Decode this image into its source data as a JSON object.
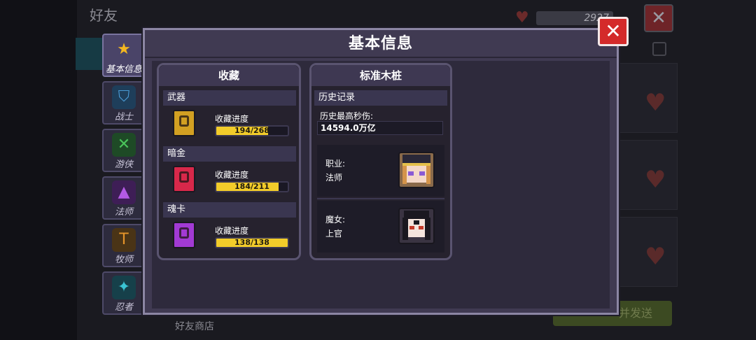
{
  "background": {
    "title": "好友",
    "currency_value": "2927",
    "send_button": "并发送",
    "shop_label": "好友商店"
  },
  "sidebar": {
    "tabs": [
      {
        "label": "基本信息",
        "icon": "star-icon",
        "active": true,
        "color": "#f4b820"
      },
      {
        "label": "战士",
        "icon": "shield-icon",
        "active": false,
        "color": "#2a6a9a"
      },
      {
        "label": "游侠",
        "icon": "crossbow-icon",
        "active": false,
        "color": "#2a8a3a"
      },
      {
        "label": "法师",
        "icon": "wizard-icon",
        "active": false,
        "color": "#8a3ab4"
      },
      {
        "label": "牧师",
        "icon": "hammer-icon",
        "active": false,
        "color": "#c47a1a"
      },
      {
        "label": "忍者",
        "icon": "shuriken-icon",
        "active": false,
        "color": "#2a9aa4"
      }
    ]
  },
  "modal": {
    "title": "基本信息",
    "close_icon": "close-icon"
  },
  "collection": {
    "title": "收藏",
    "sections": [
      {
        "name": "武器",
        "progress_label": "收藏进度",
        "progress_text": "194/268",
        "current": 194,
        "total": 268,
        "icon": "weapon-book-icon",
        "icon_color": "#d2a022"
      },
      {
        "name": "暗金",
        "progress_label": "收藏进度",
        "progress_text": "184/211",
        "current": 184,
        "total": 211,
        "icon": "dark-gold-book-icon",
        "icon_color": "#d8284a"
      },
      {
        "name": "魂卡",
        "progress_label": "收藏进度",
        "progress_text": "138/138",
        "current": 138,
        "total": 138,
        "icon": "soul-card-book-icon",
        "icon_color": "#a23ad4"
      }
    ]
  },
  "dummy": {
    "title": "标准木桩",
    "history_title": "历史记录",
    "max_dps_label": "历史最高秒伤:",
    "max_dps_value": "14594.0万亿",
    "class_label": "职业:",
    "class_value": "法师",
    "character_label": "魔女:",
    "character_value": "上官"
  }
}
